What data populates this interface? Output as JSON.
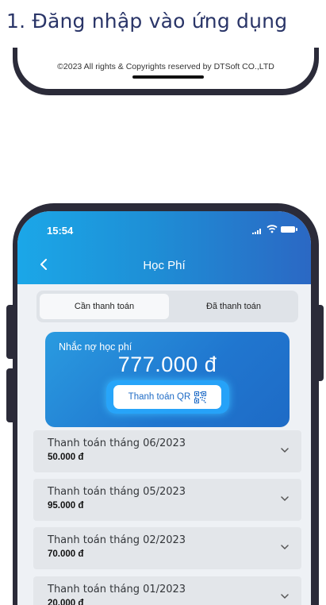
{
  "heading": "1.  Đăng nhập vào ứng dụng",
  "previous_screen": {
    "copyright": "©2023 All rights & Copyrights reserved by DTSoft CO.,LTD"
  },
  "status_bar": {
    "time": "15:54"
  },
  "nav": {
    "title": "Học Phí"
  },
  "tabs": [
    {
      "label": "Cần thanh toán",
      "active": true
    },
    {
      "label": "Đã thanh toán",
      "active": false
    }
  ],
  "debt_card": {
    "title": "Nhắc nợ học phí",
    "amount": "777.000 đ",
    "qr_button_label": "Thanh toán QR"
  },
  "payments": [
    {
      "title": "Thanh toán tháng 06/2023",
      "amount": "50.000 đ"
    },
    {
      "title": "Thanh toán tháng 05/2023",
      "amount": "95.000 đ"
    },
    {
      "title": "Thanh toán tháng 02/2023",
      "amount": "70.000 đ"
    },
    {
      "title": "Thanh toán tháng 01/2023",
      "amount": "20.000 đ"
    }
  ],
  "colors": {
    "header_gradient_start": "#1ba7e8",
    "header_gradient_end": "#2b68c4",
    "card_blue": "#2076cf",
    "device_frame": "#2b2b39",
    "heading_text": "#2a3568"
  }
}
